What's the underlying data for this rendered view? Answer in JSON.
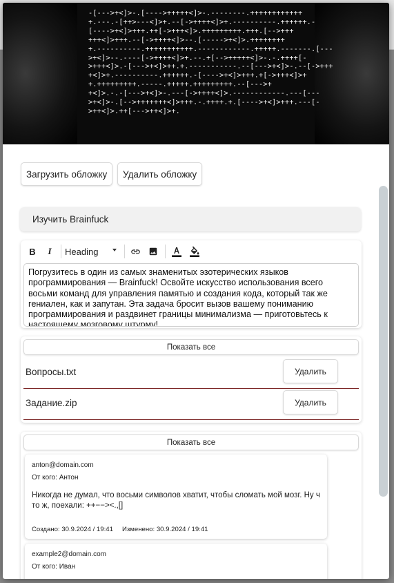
{
  "cover": {
    "code_lines": [
      "-[--->+<]>-.[---->+++++<]>-.--------.++++++++++++",
      "+.---.-[++>---<]>+.--[->++++<]>+.----------.++++++.-",
      "[---->+<]>+++.++[->+++<]>.+++++++++.+++.[-->+++",
      "+++<]>+++.--[->++++<]>--.[----->+<]>.++++++++",
      "+.----------.+++++++++++.------------.+++++.-------.[---",
      ">+<]>--.----[->++++<]>+.--.+[-->+++++<]>-.-.++++[-",
      ">+++<]>.-[--->+<]>++.+.-----------.--[--->+<]>-.--[->+++",
      "+<]>+.----------.++++++.-[---->+<]>+++.+[->+++<]>+",
      "+.+++++++++.-----.+++++.+++++++++.--[--->+",
      "+<]>.-.-[--->+<]>-.---[->++++<]>.------------.---[---",
      ">+<]>-.[-->+++++++<]>+++.-.++++.+.[---->+<]>+++.---[-",
      ">++<]>.++[--->++<]>+."
    ]
  },
  "cover_buttons": {
    "upload": "Загрузить обложку",
    "delete": "Удалить обложку"
  },
  "task": {
    "title": "Изучить Brainfuck"
  },
  "editor": {
    "bold": "B",
    "italic": "I",
    "heading": "Heading",
    "icons": [
      "bold-icon",
      "italic-icon",
      "chevron-down-icon",
      "link-icon",
      "image-icon",
      "text-color-icon",
      "fill-color-icon"
    ],
    "text": "Погрузитесь в один из самых знаменитых эзотерических языков программирования — Brainfuck! Освойте искусство использования всего восьми команд для управления памятью и создания кода, который так же гениален, как и запутан. Эта задача бросит вызов вашему пониманию программирования и раздвинет границы минимализма — приготовьтесь к настоящему мозговому штурму!"
  },
  "files": {
    "show_all": "Показать все",
    "delete_label": "Удалить",
    "items": [
      {
        "name": "Вопросы.txt"
      },
      {
        "name": "Задание.zip"
      }
    ],
    "accent_line": "#7a2323"
  },
  "comments": {
    "show_all": "Показать все",
    "items": [
      {
        "email": "anton@domain.com",
        "from": "От кого: Антон",
        "text": "Никогда не думал, что восьми символов хватит, чтобы сломать мой мозг. Ну ч то ж, поехали: ++−−><.,[]",
        "created": "Создано: 30.9.2024 / 19:41",
        "modified": "Изменено: 30.9.2024 / 19:41"
      },
      {
        "email": "example2@domain.com",
        "from": "От кого: Иван"
      }
    ]
  }
}
